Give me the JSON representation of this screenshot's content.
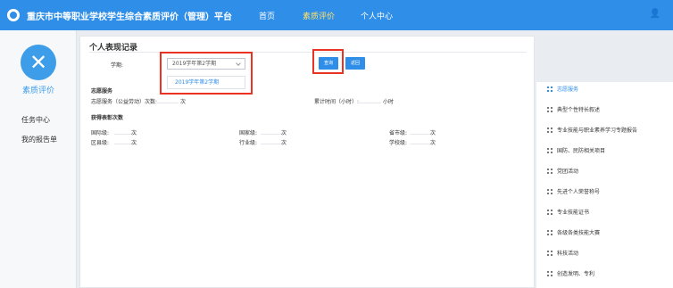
{
  "header": {
    "title": "重庆市中等职业学校学生综合素质评价（管理）平台",
    "nav": [
      "首页",
      "素质评价",
      "个人中心"
    ],
    "user_icon": "user-icon"
  },
  "sidebar": {
    "module_icon": "pencil-ruler-icon",
    "title": "素质评价",
    "links": [
      "任务中心",
      "我的报告单"
    ]
  },
  "main": {
    "title": "个人表现记录",
    "term_label": "学期:",
    "term_value": "2019学年第2学期",
    "term_option": "2019学年第2学期",
    "search_label": "查询",
    "back_label": "返回",
    "volunteer_section": "志愿服务",
    "volunteer_count_label": "志愿服务（公益劳动）次数:",
    "volunteer_count_unit": "次",
    "cumulative_time_label": "累计时间（小时）:",
    "cumulative_time_unit": "小时",
    "awards_section": "获得表彰次数",
    "awards": [
      {
        "label": "国际级:",
        "unit": "次"
      },
      {
        "label": "国家级:",
        "unit": "次"
      },
      {
        "label": "省市级:",
        "unit": "次"
      },
      {
        "label": "区县级:",
        "unit": "次"
      },
      {
        "label": "行业级:",
        "unit": "次"
      },
      {
        "label": "学校级:",
        "unit": "次"
      }
    ]
  },
  "right_nav": {
    "items": [
      "志愿服务",
      "典型个性特长叙述",
      "专业技能与职业素养学习专题报告",
      "国防、民防相关项目",
      "党团活动",
      "先进个人荣誉称号",
      "专业技能证书",
      "各级各类技能大赛",
      "科技活动",
      "创造发明、专利"
    ]
  },
  "colors": {
    "header": "#2f8ee8",
    "accent": "#2f8ee8",
    "active_nav": "#ffe26a",
    "highlight_box": "#ea3323"
  }
}
